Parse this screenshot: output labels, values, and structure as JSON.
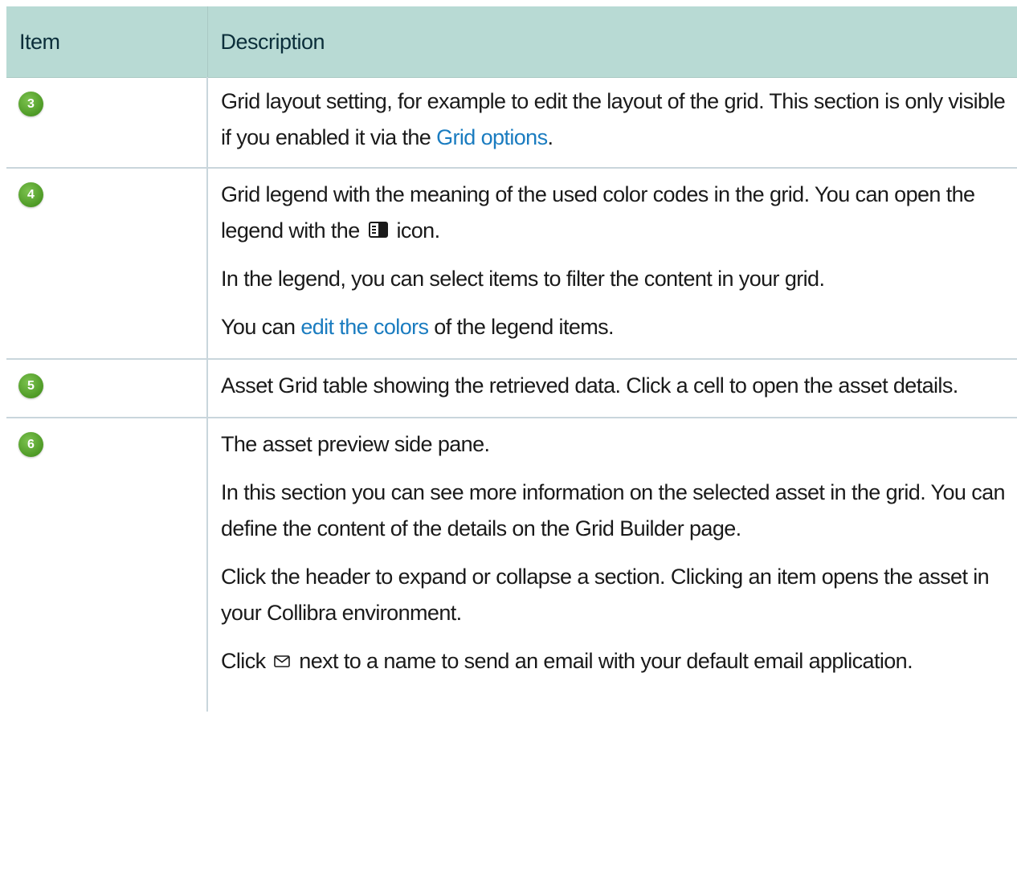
{
  "table": {
    "header": {
      "item": "Item",
      "description": "Description"
    },
    "rows": [
      {
        "badge": "3",
        "p1_a": "Grid layout setting, for example to edit the layout of the grid. This section is only visible if you enabled it via the ",
        "p1_link": "Grid options",
        "p1_b": "."
      },
      {
        "badge": "4",
        "p1_a": "Grid legend with the meaning of the used color codes in the grid. You can open the legend with the ",
        "p1_icon": "legend-icon",
        "p1_b": " icon.",
        "p2": "In the legend, you can select items to filter the content in your grid.",
        "p3_a": "You can ",
        "p3_link": "edit the colors",
        "p3_b": " of the legend items."
      },
      {
        "badge": "5",
        "p1": "Asset Grid table showing the retrieved data. Click a cell to open the asset details."
      },
      {
        "badge": "6",
        "p1": "The asset preview side pane.",
        "p2": "In this section you can see more information on the selected asset in the grid. You can define the content of the details on the Grid Builder page.",
        "p3": "Click the header to expand or collapse a section. Clicking an item opens the asset in your Collibra environment.",
        "p4_a": "Click ",
        "p4_icon": "email-icon",
        "p4_b": " next to a name to send an email with your default email application."
      }
    ]
  },
  "colors": {
    "header_bg": "#b8dad4",
    "badge_green": "#4e9a26",
    "link": "#1a7cc0"
  }
}
